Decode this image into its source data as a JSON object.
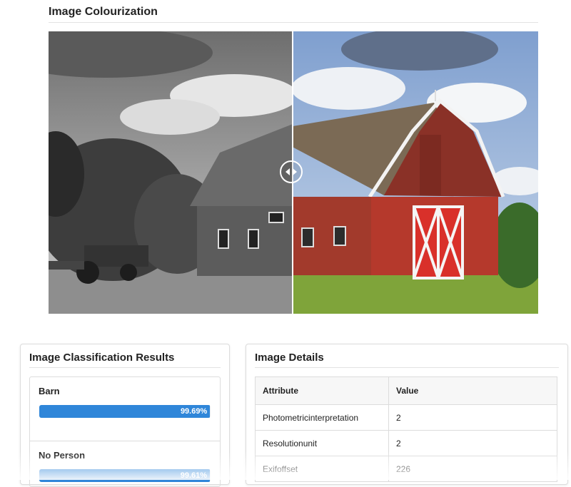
{
  "colourization": {
    "title": "Image Colourization",
    "slider_position": 0.5
  },
  "classification": {
    "title": "Image Classification Results",
    "items": [
      {
        "label": "Barn",
        "percent": "99.69%",
        "value": 0.9969
      },
      {
        "label": "No Person",
        "percent": "99.61%",
        "value": 0.9961
      }
    ]
  },
  "details": {
    "title": "Image Details",
    "columns": [
      "Attribute",
      "Value"
    ],
    "rows": [
      [
        "Photometricinterpretation",
        "2"
      ],
      [
        "Resolutionunit",
        "2"
      ],
      [
        "Exifoffset",
        "226"
      ]
    ]
  },
  "colors": {
    "progress": "#2f86d9",
    "barn_red": "#b5392c"
  }
}
